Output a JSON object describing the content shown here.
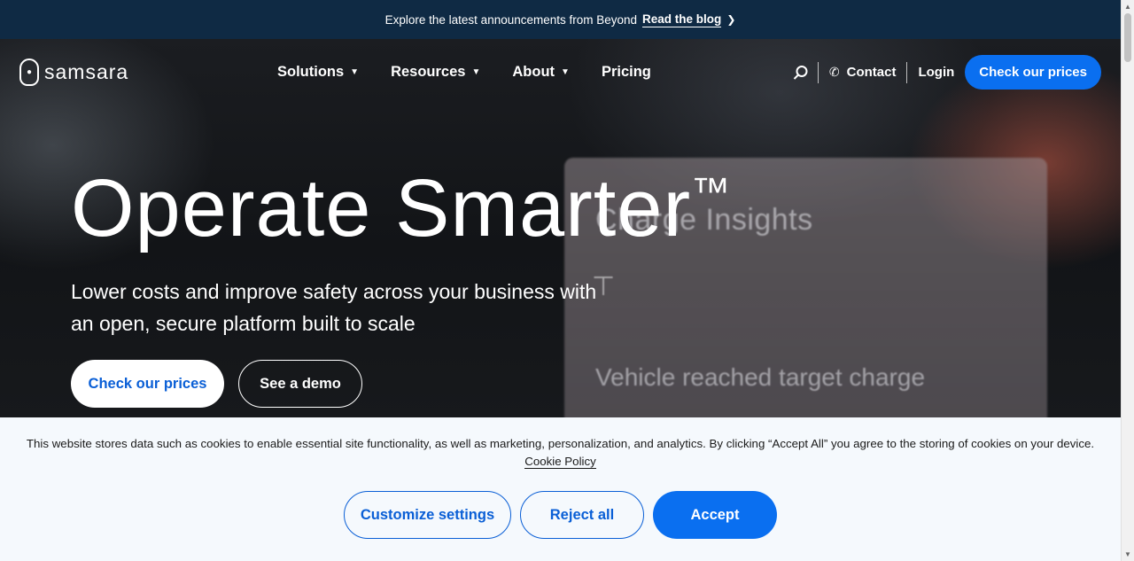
{
  "announcement": {
    "message": "Explore the latest announcements from Beyond",
    "link_label": "Read the blog",
    "chevron_icon": "chevron-right-icon"
  },
  "nav": {
    "logo_text": "samsara",
    "menu": [
      {
        "label": "Solutions",
        "has_dropdown": true
      },
      {
        "label": "Resources",
        "has_dropdown": true
      },
      {
        "label": "About",
        "has_dropdown": true
      },
      {
        "label": "Pricing",
        "has_dropdown": false
      }
    ],
    "search_icon": "search-icon",
    "contact_label": "Contact",
    "login_label": "Login",
    "cta_label": "Check our prices"
  },
  "hero": {
    "headline": "Operate Smarter",
    "trademark": "™",
    "subline": "Lower costs and improve safety across your business with an open, secure platform built to scale",
    "primary_cta": "Check our prices",
    "secondary_cta": "See a demo",
    "background_panel_title": "Charge Insights",
    "background_panel_sub": "Vehicle reached target charge"
  },
  "cookie_banner": {
    "text": "This website stores data such as cookies to enable essential site functionality, as well as marketing, personalization, and analytics. By clicking “Accept All” you agree to the storing of cookies on your device.",
    "policy_label": "Cookie Policy",
    "customize_label": "Customize settings",
    "reject_label": "Reject all",
    "accept_label": "Accept"
  },
  "colors": {
    "announcement_bg": "#0f2a44",
    "primary_blue": "#0a6ff0",
    "banner_bg": "#f5f9fd"
  }
}
